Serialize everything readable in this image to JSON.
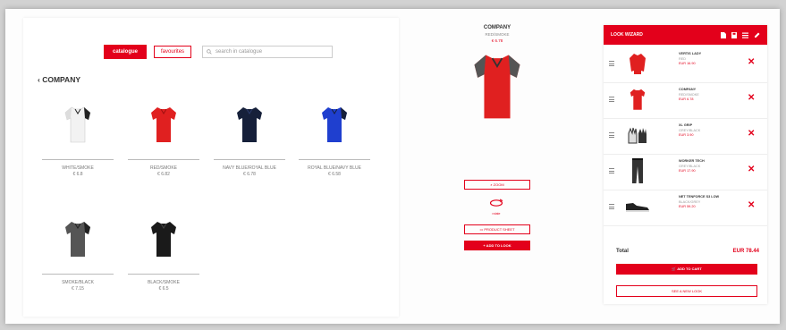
{
  "catalog": {
    "catalogue_btn": "catalogue",
    "favourites_btn": "favourites",
    "search_placeholder": "search in catalogue",
    "back_label": "‹ COMPANY",
    "products": [
      {
        "name": "WHITE/SMOKE",
        "price": "€ 6.8",
        "color": "#f2f2f2",
        "trim": "#222222"
      },
      {
        "name": "RED/SMOKE",
        "price": "€ 6.82",
        "color": "#e02020",
        "trim": "#c41818"
      },
      {
        "name": "NAVY BLUE/ROYAL BLUE",
        "price": "€ 6.78",
        "color": "#16203a",
        "trim": "#101828"
      },
      {
        "name": "ROYAL BLUE/NAVY BLUE",
        "price": "€ 6.58",
        "color": "#1f3fcf",
        "trim": "#172f9f"
      },
      {
        "name": "SMOKE/BLACK",
        "price": "€ 7.15",
        "color": "#555555",
        "trim": "#222222"
      },
      {
        "name": "BLACK/SMOKE",
        "price": "€ 6.5",
        "color": "#1a1a1a",
        "trim": "#111111"
      }
    ]
  },
  "detail": {
    "brand": "COMPANY",
    "variant": "RED/SMOKE",
    "price": "€ 6.78",
    "zoom_label": "ZOOM",
    "rotate_label": "rotate",
    "product_sheet_label": "PRODUCT SHEET",
    "add_to_look_label": "+ ADD TO LOOK"
  },
  "look": {
    "title": "LOOK WIZARD",
    "items": [
      {
        "title": "VERTIS LADY",
        "sub": "RED",
        "price": "EUR 16.90"
      },
      {
        "title": "COMPANY",
        "sub": "RED/SMOKE",
        "price": "EUR 6.78"
      },
      {
        "title": "XL GRIP",
        "sub": "GREY/BLACK",
        "price": "EUR 3.90"
      },
      {
        "title": "WORKER TECH",
        "sub": "GREY/BLACK",
        "price": "EUR 17.90"
      },
      {
        "title": "NET TENFORCE S3 LOW",
        "sub": "BLACK/GREY",
        "price": "EUR 59.20"
      }
    ],
    "total_label": "Total",
    "total_value": "EUR 78.44",
    "add_to_cart_label": "ADD TO CART",
    "new_look_label": "SEE A NEW LOOK"
  },
  "colors": {
    "accent": "#e3001b"
  }
}
